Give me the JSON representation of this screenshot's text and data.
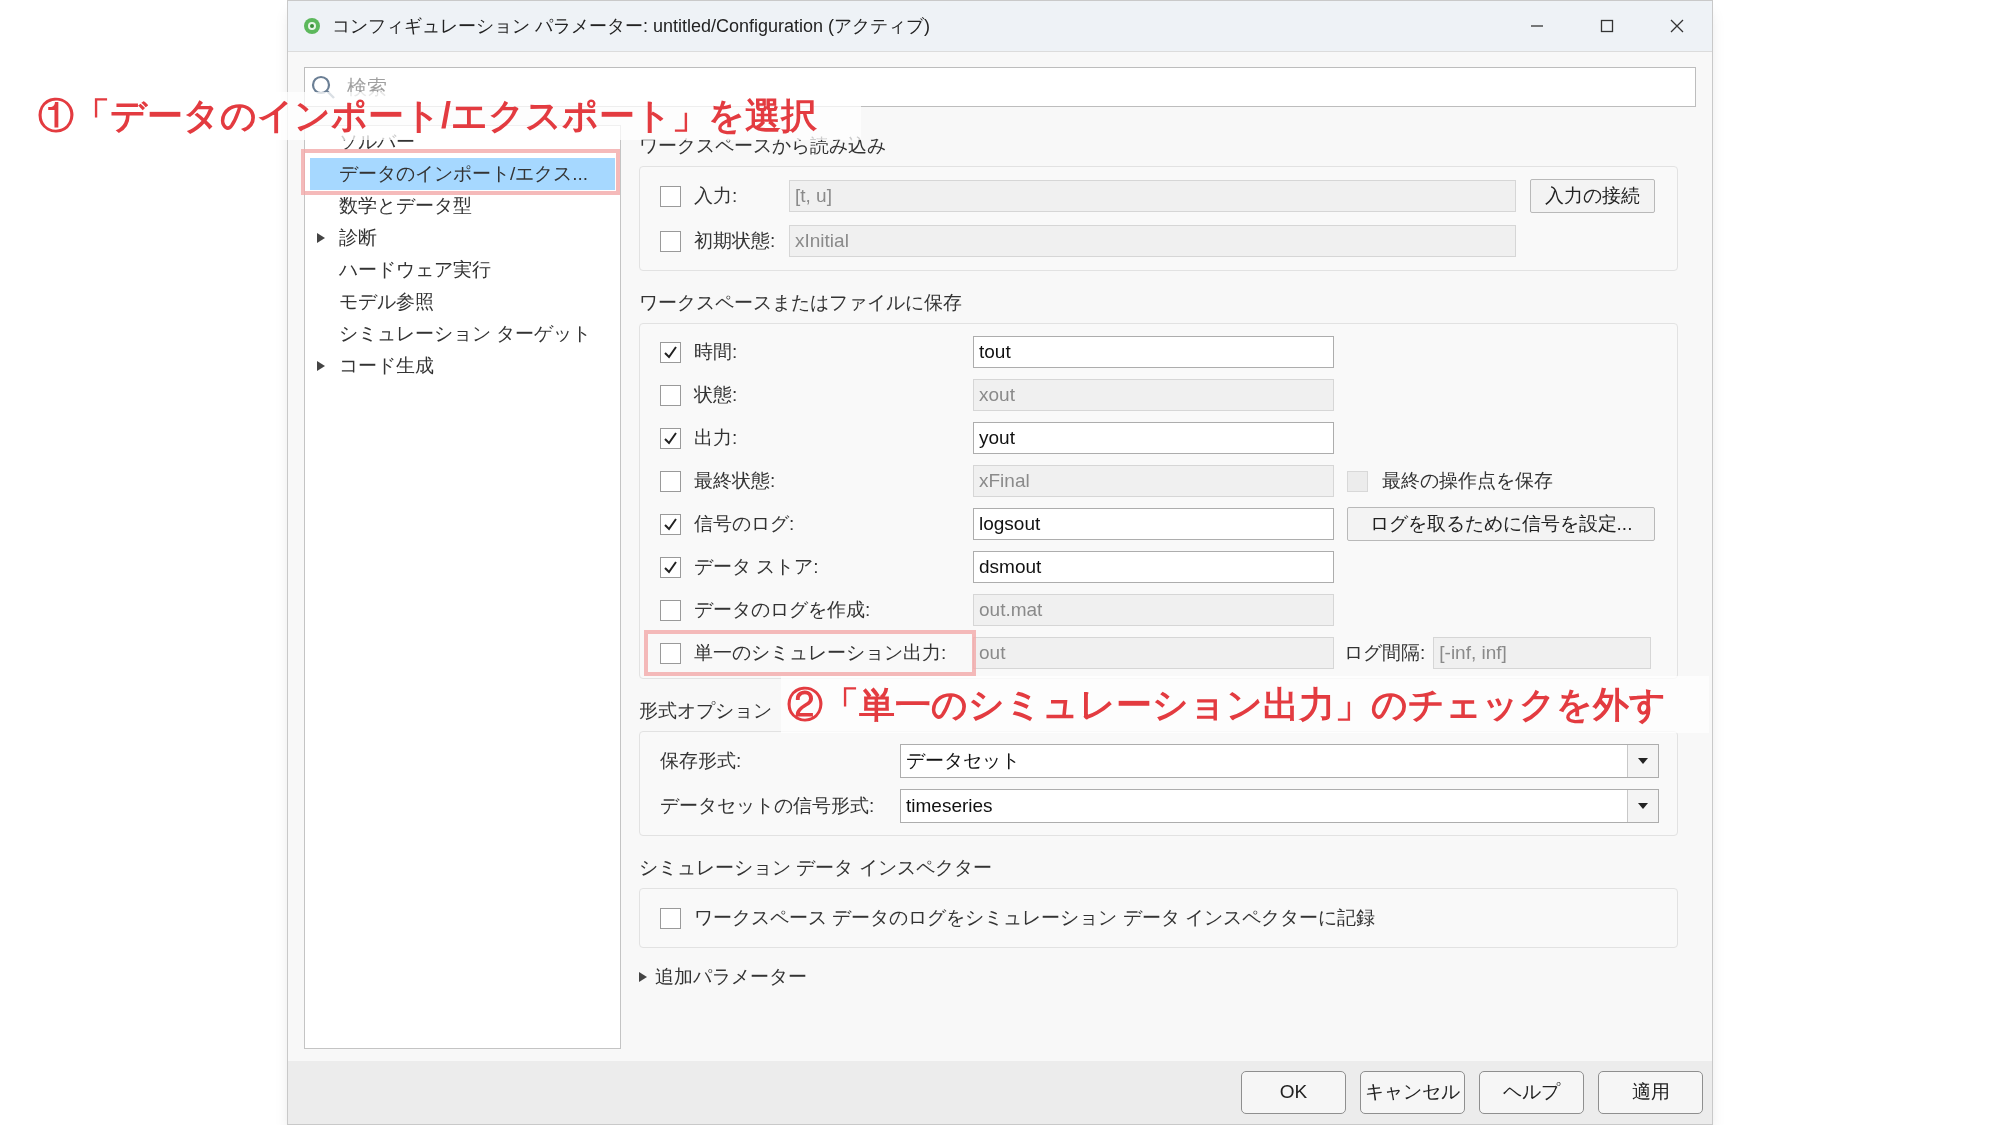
{
  "window": {
    "title": "コンフィギュレーション パラメーター: untitled/Configuration (アクティブ)"
  },
  "search": {
    "placeholder": "検索"
  },
  "sidebar": {
    "items": [
      {
        "label": "ソルバー",
        "selected": false,
        "expandable": false
      },
      {
        "label": "データのインポート/エクス...",
        "selected": true,
        "expandable": false
      },
      {
        "label": "数学とデータ型",
        "selected": false,
        "expandable": false
      },
      {
        "label": "診断",
        "selected": false,
        "expandable": true
      },
      {
        "label": "ハードウェア実行",
        "selected": false,
        "expandable": false
      },
      {
        "label": "モデル参照",
        "selected": false,
        "expandable": false
      },
      {
        "label": "シミュレーション ターゲット",
        "selected": false,
        "expandable": false
      },
      {
        "label": "コード生成",
        "selected": false,
        "expandable": true
      }
    ]
  },
  "sections": [
    {
      "kind": "load",
      "title": "ワークスペースから読み込み",
      "rows": [
        {
          "label": "入力:",
          "checked": false,
          "value": "[t, u]",
          "extra": {
            "kind": "button",
            "label": "入力の接続"
          }
        },
        {
          "label": "初期状態:",
          "checked": false,
          "value": "xInitial"
        }
      ]
    },
    {
      "kind": "save",
      "title": "ワークスペースまたはファイルに保存",
      "rows": [
        {
          "label": "時間:",
          "checked": true,
          "value": "tout"
        },
        {
          "label": "状態:",
          "checked": false,
          "value": "xout"
        },
        {
          "label": "出力:",
          "checked": true,
          "value": "yout"
        },
        {
          "label": "最終状態:",
          "checked": false,
          "value": "xFinal",
          "extra": {
            "kind": "checkbox",
            "label": "最終の操作点を保存",
            "checked": false
          }
        },
        {
          "label": "信号のログ:",
          "checked": true,
          "value": "logsout",
          "extra": {
            "kind": "button",
            "label": "ログを取るために信号を設定..."
          }
        },
        {
          "label": "データ ストア:",
          "checked": true,
          "value": "dsmout"
        },
        {
          "label": "データのログを作成:",
          "checked": false,
          "value": "out.mat"
        },
        {
          "label": "単一のシミュレーション出力:",
          "checked": false,
          "value": "out",
          "extra": {
            "kind": "field",
            "label": "ログ間隔:",
            "value": "[-inf, inf]"
          }
        }
      ]
    },
    {
      "kind": "format",
      "title": "形式オプション",
      "rows": [
        {
          "label": "保存形式:",
          "value": "データセット"
        },
        {
          "label": "データセットの信号形式:",
          "value": "timeseries"
        }
      ]
    },
    {
      "kind": "inspector",
      "title": "シミュレーション データ インスペクター",
      "rows": [
        {
          "label": "ワークスペース データのログをシミュレーション データ インスペクターに記録",
          "checked": false
        }
      ]
    }
  ],
  "more": {
    "label": "追加パラメーター",
    "expanded": false
  },
  "buttons": [
    "OK",
    "キャンセル",
    "ヘルプ",
    "適用"
  ],
  "annotations": [
    {
      "kind": "sidebar",
      "text": "①「データのインポート/エクスポート」を選択"
    },
    {
      "kind": "row",
      "text": "②「単一のシミュレーション出力」のチェックを外す"
    }
  ]
}
